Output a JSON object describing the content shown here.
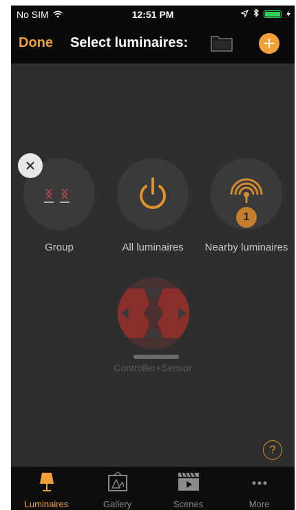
{
  "status_bar": {
    "carrier": "No SIM",
    "time": "12:51 PM"
  },
  "nav": {
    "done_label": "Done",
    "title": "Select luminaires:"
  },
  "items": [
    {
      "label": "Group"
    },
    {
      "label": "All luminaires"
    },
    {
      "label": "Nearby luminaires",
      "badge": "1"
    }
  ],
  "controller": {
    "label": "Controller+Sensor"
  },
  "help_label": "?",
  "tabs": [
    {
      "label": "Luminaires",
      "active": true
    },
    {
      "label": "Gallery"
    },
    {
      "label": "Scenes"
    },
    {
      "label": "More"
    }
  ],
  "colors": {
    "accent": "#f0a13a",
    "background": "#2f2f2f",
    "bar": "#0a0a0a"
  }
}
